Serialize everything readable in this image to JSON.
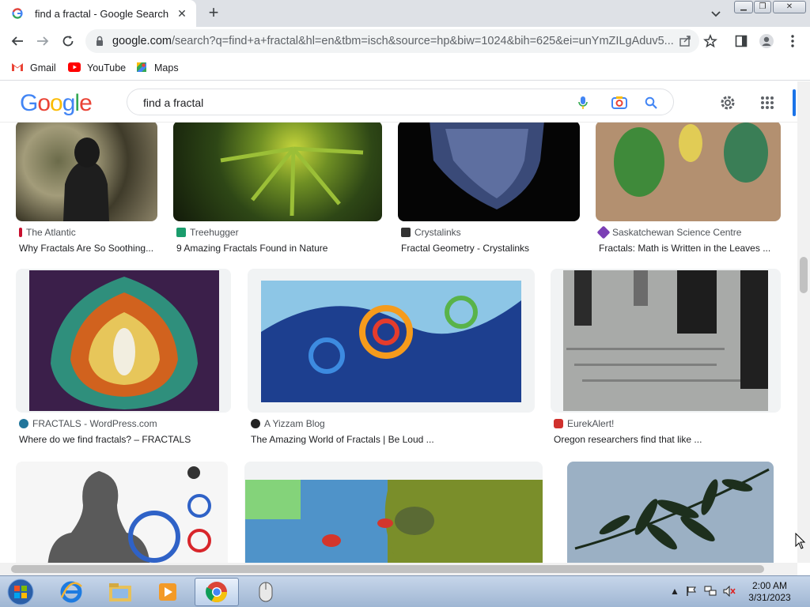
{
  "browser": {
    "tab_title": "find a fractal - Google Search",
    "url_host": "google.com",
    "url_rest": "/search?q=find+a+fractal&hl=en&tbm=isch&source=hp&biw=1024&bih=625&ei=unYmZILgAduv5...",
    "bookmarks": [
      {
        "label": "Gmail",
        "icon": "gmail-icon"
      },
      {
        "label": "YouTube",
        "icon": "youtube-icon"
      },
      {
        "label": "Maps",
        "icon": "maps-icon"
      }
    ]
  },
  "google": {
    "logo": "Google",
    "query": "find a fractal"
  },
  "results": {
    "row1": [
      {
        "source": "The Atlantic",
        "title": "Why Fractals Are So Soothing...",
        "fav_color": "#c8102e"
      },
      {
        "source": "Treehugger",
        "title": "9 Amazing Fractals Found in Nature",
        "fav_color": "#1a9c6c"
      },
      {
        "source": "Crystalinks",
        "title": "Fractal Geometry - Crystalinks",
        "fav_color": "#333333"
      },
      {
        "source": "Saskatchewan Science Centre",
        "title": "Fractals: Math is Written in the Leaves ...",
        "fav_color": "#7b3fb5"
      }
    ],
    "row2": [
      {
        "source": "FRACTALS - WordPress.com",
        "title": "Where do we find fractals? – FRACTALS",
        "fav_color": "#21759b"
      },
      {
        "source": "A Yizzam Blog",
        "title": "The Amazing World of Fractals | Be Loud ...",
        "fav_color": "#222222"
      },
      {
        "source": "EurekAlert!",
        "title": "Oregon researchers find that like ...",
        "fav_color": "#d0312d"
      }
    ]
  },
  "taskbar": {
    "time": "2:00 AM",
    "date": "3/31/2023"
  }
}
